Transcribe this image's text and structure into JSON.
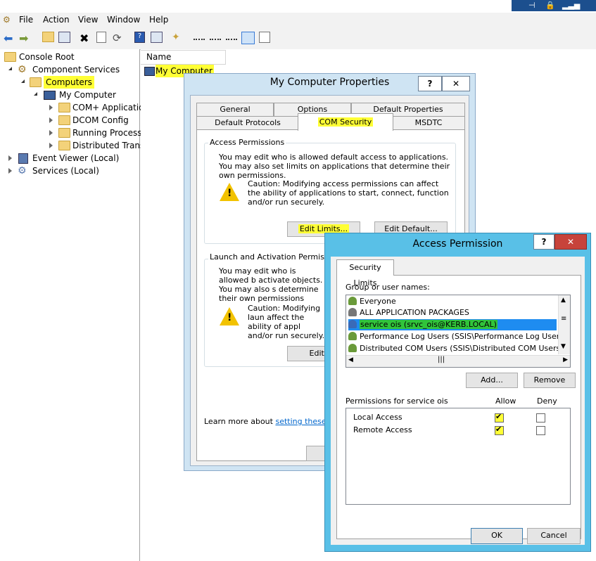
{
  "menubar": {
    "items": [
      "File",
      "Action",
      "View",
      "Window",
      "Help"
    ]
  },
  "tree": {
    "root": "Console Root",
    "component_services": "Component Services",
    "computers": "Computers",
    "my_computer": "My Computer",
    "com_apps": "COM+ Applicatio",
    "dcom": "DCOM Config",
    "running": "Running Processe",
    "dtc": "Distributed Transa",
    "event_viewer": "Event Viewer (Local)",
    "services": "Services (Local)"
  },
  "list": {
    "header_name": "Name",
    "item": "My Computer"
  },
  "props": {
    "title": "My Computer Properties",
    "help": "?",
    "close": "✕",
    "tabs_top": [
      "General",
      "Options",
      "Default Properties"
    ],
    "tabs_bottom": [
      "Default Protocols",
      "COM Security",
      "MSDTC"
    ],
    "access": {
      "title": "Access Permissions",
      "desc": "You may edit who is allowed default access to applications. You may also set limits on applications that determine their own permissions.",
      "caution": "Caution: Modifying access permissions can affect the ability of applications to start, connect, function and/or run securely.",
      "edit_limits": "Edit Limits...",
      "edit_default": "Edit Default..."
    },
    "launch": {
      "title": "Launch and Activation Permissions",
      "desc": "You may edit who is allowed b activate objects. You may also s determine their own permissions",
      "caution": "Caution: Modifying laun affect the ability of appl and/or run securely.",
      "edit_limits": "Edit Lin"
    },
    "learn_more_prefix": "Learn more about ",
    "learn_more_link": "setting these prope",
    "ok": "O"
  },
  "ap": {
    "title": "Access Permission",
    "help": "?",
    "close": "✕",
    "tab": "Security Limits",
    "group_label": "Group or user names:",
    "users": [
      {
        "name": "Everyone",
        "color": "#6a9a3a"
      },
      {
        "name": "ALL APPLICATION PACKAGES",
        "color": "#777777"
      },
      {
        "name": "service ois (srvc_ois@KERB.LOCAL)",
        "color": "#3a6ab8"
      },
      {
        "name": "Performance Log Users (SSIS\\Performance Log Users)",
        "color": "#6a9a3a"
      },
      {
        "name": "Distributed COM Users (SSIS\\Distributed COM Users)",
        "color": "#6a9a3a"
      }
    ],
    "add": "Add...",
    "remove": "Remove",
    "perm_label": "Permissions for service ois",
    "allow": "Allow",
    "deny": "Deny",
    "perms": [
      {
        "name": "Local Access",
        "allow": true,
        "deny": false
      },
      {
        "name": "Remote Access",
        "allow": true,
        "deny": false
      }
    ],
    "ok": "OK",
    "cancel": "Cancel"
  }
}
